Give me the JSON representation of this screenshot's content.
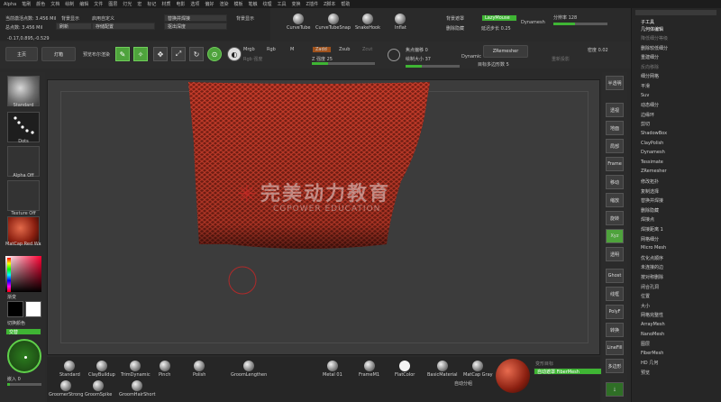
{
  "menubar": [
    "Alpha",
    "笔刷",
    "颜色",
    "文档",
    "绘制",
    "编辑",
    "文件",
    "图层",
    "灯光",
    "宏",
    "标记",
    "材质",
    "电影",
    "选项",
    "偏好",
    "渲染",
    "模板",
    "笔触",
    "纹理",
    "工具",
    "变换",
    "Z插件",
    "Z脚本",
    "帮助"
  ],
  "topinfo": {
    "active_points": "当前激活点数: 3.456 Mil",
    "bg_display": "背景显示",
    "total_points": "总点数: 3.456 Mil",
    "coords": "-0.17,0.895,-0.529",
    "enable_custom": "启用自定义",
    "refresh": "刷新",
    "save_config": "存储配置",
    "replace_hotkey": "替换预设",
    "bg_display2": "背景显示",
    "dynamic_brush": "替换并焊接",
    "mask_extract": "抠出深度",
    "home": "主页",
    "lightbox": "灯箱",
    "preview": "预览布尔渲染"
  },
  "curve_brushes": [
    "CurveTube",
    "CurveTubeSnap",
    "SnakeHook",
    "Inflat"
  ],
  "top_right": {
    "mask": "背景遮罩",
    "lazy_mouse": "LazyMouse",
    "dynamesh": "Dynamesh",
    "brush_size_label": "分辨率",
    "brush_size_value": "128",
    "delete_hidden": "删除隐藏",
    "lazy_step": "延迟步长 0.25"
  },
  "toolbar2": {
    "edit": "Edit",
    "draw": "Draw",
    "move": "Move",
    "scale": "Scale",
    "rotate": "Rotate",
    "mrgb": "Mrgb",
    "rgb": "Rgb",
    "m": "M",
    "zadd": "Zadd",
    "zsub": "Zsub",
    "zcut": "Zcut",
    "rgb_intensity": "Rgb 强度",
    "z_intensity_label": "Z 强度",
    "z_intensity_value": "25",
    "focal_shift_label": "焦点偏移",
    "focal_shift_value": "0",
    "draw_size_label": "绘制大小",
    "draw_size_value": "37",
    "dynamic": "Dynamic",
    "zremesher": "ZRemesher",
    "poly_count_label": "目标多边形数",
    "poly_count_value": "5",
    "reproject": "重新投影",
    "density": "密度",
    "density_value": "0.02"
  },
  "left_shelf": {
    "brush": "Standard",
    "stroke": "Dots",
    "alpha": "Alpha Off",
    "texture": "Texture Off",
    "material": "MatCap Red Wax",
    "gradient": "渐变",
    "switch_color": "切换颜色",
    "alternate": "交替",
    "radius_label": "嵌入",
    "radius_value": "0"
  },
  "viewport": {
    "watermark_cn": "完美动力教育",
    "watermark_en": "CGPOWER EDUCATION"
  },
  "right_shelf": [
    "半透明",
    "透视",
    "地面",
    "局部",
    "Frame",
    "移动",
    "缩放",
    "旋转",
    "Xyz",
    "透明",
    "Ghost",
    "线框",
    "PolyF",
    "转换",
    "LineFill",
    "多边形"
  ],
  "right_panel": {
    "header": "子工具",
    "geometry": "几何体编辑",
    "items": [
      {
        "label": "降低细分等级",
        "dim": true
      },
      {
        "label": "删除较低细分",
        "dim": false
      },
      {
        "label": "重建细分",
        "dim": false
      },
      {
        "label": "反向移除",
        "dim": true
      },
      {
        "label": "细分网格",
        "dim": false
      },
      {
        "label": "平滑",
        "dim": false
      },
      {
        "label": "Suv",
        "dim": false
      },
      {
        "label": "动态细分",
        "dim": false
      },
      {
        "label": "边缘环",
        "dim": false
      },
      {
        "label": "剪切",
        "dim": false
      },
      {
        "label": "ShadowBox",
        "dim": false
      },
      {
        "label": "ClayPolish",
        "dim": false
      },
      {
        "label": "Dynamesh",
        "dim": false
      },
      {
        "label": "Tessimate",
        "dim": false
      },
      {
        "label": "ZRemesher",
        "dim": false
      },
      {
        "label": "修改拓扑",
        "dim": false
      },
      {
        "label": "复制选择",
        "dim": false
      },
      {
        "label": "替换并焊接",
        "dim": false
      },
      {
        "label": "删除隐藏",
        "dim": false
      },
      {
        "label": "焊接点",
        "dim": false
      },
      {
        "label": "焊接距离 1",
        "dim": false
      },
      {
        "label": "网格细分",
        "dim": false
      },
      {
        "label": "Micro Mesh",
        "dim": false
      },
      {
        "label": "优化点顺序",
        "dim": false
      },
      {
        "label": "未连接的边",
        "dim": false
      },
      {
        "label": "按对称删除",
        "dim": false
      },
      {
        "label": "闭合孔洞",
        "dim": false
      },
      {
        "label": "位置",
        "dim": false
      },
      {
        "label": "大小",
        "dim": false
      },
      {
        "label": "网格完整性",
        "dim": false
      },
      {
        "label": "ArrayMesh",
        "dim": false
      },
      {
        "label": "NanoMesh",
        "dim": false
      },
      {
        "label": "图层",
        "dim": false
      },
      {
        "label": "FiberMesh",
        "dim": false
      },
      {
        "label": "HD 几何",
        "dim": false
      },
      {
        "label": "预览",
        "dim": false
      }
    ]
  },
  "bottom": {
    "brushes": [
      "Standard",
      "ClayBuildup",
      "TrimDynamic",
      "Pinch",
      "Polish",
      "GroomLengthen",
      "GroomerStrong",
      "GroomSpike",
      "GroomHairShort"
    ],
    "materials": [
      "Metal 01",
      "FrameM1",
      "FlatColor",
      "BasicMaterial",
      "MatCap Gray"
    ],
    "auto_mask": "自动遮罩 FiberMesh",
    "auto_group": "自动分组",
    "morph_label": "变形目标"
  },
  "colors": {
    "accent": "#3fb534",
    "mesh": "#c0392b",
    "bg": "#2a2a2a"
  }
}
